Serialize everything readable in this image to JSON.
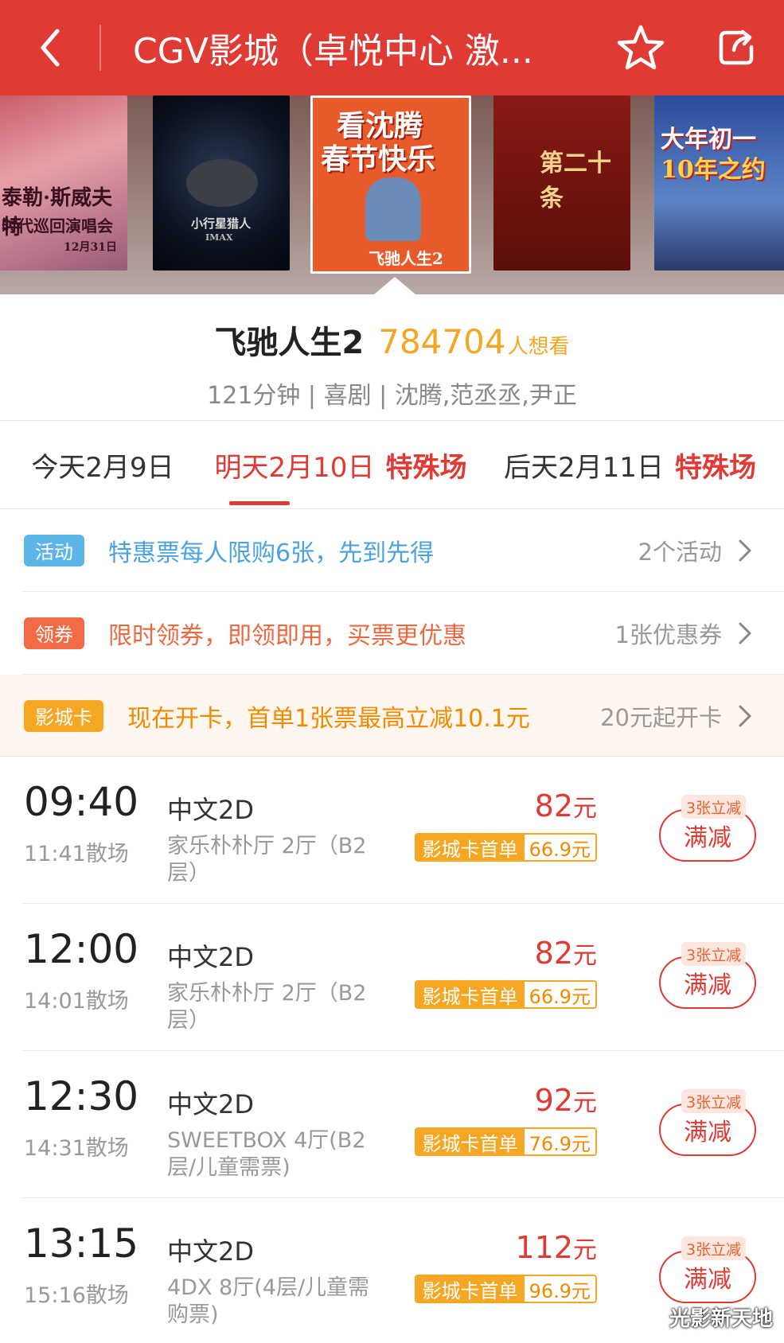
{
  "header": {
    "title": "CGV影城（卓悦中心 激...",
    "bg_color": "#e03a34"
  },
  "posters": [
    {
      "lines": [
        "泰勒·斯威夫特",
        "时代巡回演唱会",
        "12月31日"
      ]
    },
    {
      "lines": [
        "小行星猎人",
        "IMAX"
      ]
    },
    {
      "lines": [
        "看沈腾",
        "春节快乐",
        "飞驰人生2"
      ]
    },
    {
      "lines": [
        "第二十条"
      ]
    },
    {
      "lines": [
        "大年初一",
        "10年之约"
      ]
    }
  ],
  "movie": {
    "name": "飞驰人生2",
    "want_count": "784704",
    "want_suffix": "人想看",
    "meta": "121分钟 | 喜剧 | 沈腾,范丞丞,尹正"
  },
  "date_tabs": [
    {
      "label": "今天2月9日",
      "special": ""
    },
    {
      "label": "明天2月10日",
      "special": "特殊场"
    },
    {
      "label": "后天2月11日",
      "special": "特殊场"
    }
  ],
  "promos": [
    {
      "badge": "活动",
      "badge_color": "#5bb5e8",
      "text": "特惠票每人限购6张，先到先得",
      "text_color": "#4aa3df",
      "right": "2个活动",
      "bg": "#ffffff"
    },
    {
      "badge": "领券",
      "badge_color": "#f26b45",
      "text": "限时领券，即领即用，买票更优惠",
      "text_color": "#f0683f",
      "right": "1张优惠券",
      "bg": "#ffffff"
    },
    {
      "badge": "影城卡",
      "badge_color": "#f5a623",
      "text": "现在开卡，首单1张票最高立减10.1元",
      "text_color": "#f08a00",
      "right": "20元起开卡",
      "bg": "#fff7ef"
    }
  ],
  "showtimes": [
    {
      "start": "09:40",
      "end": "11:41散场",
      "lang": "中文2D",
      "hall": "家乐朴朴厅 2厅（B2层）",
      "price": "82",
      "price_unit": "元",
      "card_label": "影城卡首单",
      "card_price": "66.9元",
      "discount": "3张立减",
      "button": "满减"
    },
    {
      "start": "12:00",
      "end": "14:01散场",
      "lang": "中文2D",
      "hall": "家乐朴朴厅 2厅（B2层）",
      "price": "82",
      "price_unit": "元",
      "card_label": "影城卡首单",
      "card_price": "66.9元",
      "discount": "3张立减",
      "button": "满减"
    },
    {
      "start": "12:30",
      "end": "14:31散场",
      "lang": "中文2D",
      "hall": "SWEETBOX 4厅(B2层/儿童需票)",
      "price": "92",
      "price_unit": "元",
      "card_label": "影城卡首单",
      "card_price": "76.9元",
      "discount": "3张立减",
      "button": "满减"
    },
    {
      "start": "13:15",
      "end": "15:16散场",
      "lang": "中文2D",
      "hall": "4DX 8厅(4层/儿童需购票)",
      "price": "112",
      "price_unit": "元",
      "card_label": "影城卡首单",
      "card_price": "96.9元",
      "discount": "3张立减",
      "button": "满减"
    }
  ],
  "watermark": "光影新天地",
  "icons": {
    "back": "chevron-left-icon",
    "favorite": "star-icon",
    "share": "share-icon",
    "chevron": "chevron-right-icon"
  }
}
